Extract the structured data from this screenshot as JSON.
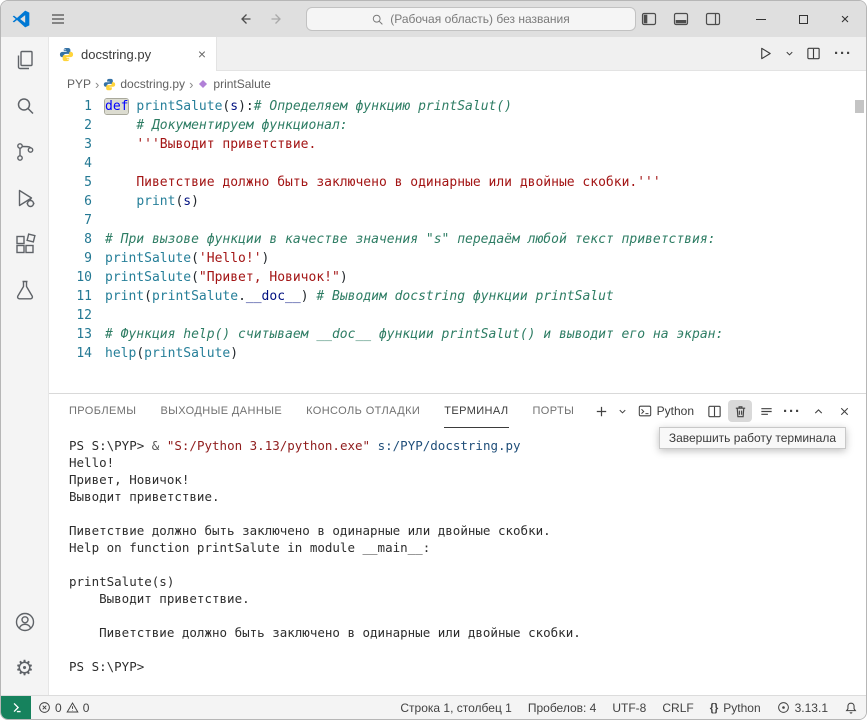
{
  "colors": {
    "accent": "#005fb8",
    "remote_indicator": "#16825d",
    "keyword": "#0000ff",
    "function": "#267f99",
    "string": "#a31515",
    "comment": "#2e7d64",
    "line_number": "#237893",
    "python_blue": "#3572a5",
    "python_yellow": "#ffd43b"
  },
  "titlebar": {
    "command_center": "(Рабочая область) без названия"
  },
  "tab": {
    "label": "docstring.py"
  },
  "breadcrumbs": {
    "items": [
      "PYP",
      "docstring.py",
      "printSalute"
    ]
  },
  "editor": {
    "lines": [
      {
        "n": "1",
        "tokens": [
          {
            "t": "def",
            "c": "k",
            "hl": true
          },
          {
            "t": " ",
            "c": "p"
          },
          {
            "t": "printSalute",
            "c": "f"
          },
          {
            "t": "(",
            "c": "p"
          },
          {
            "t": "s",
            "c": "v"
          },
          {
            "t": "):",
            "c": "p"
          },
          {
            "t": "# Определяем функцию printSalut()",
            "c": "c"
          }
        ]
      },
      {
        "n": "2",
        "tokens": [
          {
            "t": "    ",
            "c": "p"
          },
          {
            "t": "# Документируем функционал:",
            "c": "c"
          }
        ]
      },
      {
        "n": "3",
        "tokens": [
          {
            "t": "    ",
            "c": "p"
          },
          {
            "t": "'''Выводит приветствие.",
            "c": "s"
          }
        ]
      },
      {
        "n": "4",
        "tokens": []
      },
      {
        "n": "5",
        "tokens": [
          {
            "t": "    ",
            "c": "p"
          },
          {
            "t": "Пиветствие должно быть заключено в одинарные или двойные скобки.'''",
            "c": "s"
          }
        ]
      },
      {
        "n": "6",
        "tokens": [
          {
            "t": "    ",
            "c": "p"
          },
          {
            "t": "print",
            "c": "f"
          },
          {
            "t": "(",
            "c": "p"
          },
          {
            "t": "s",
            "c": "v"
          },
          {
            "t": ")",
            "c": "p"
          }
        ]
      },
      {
        "n": "7",
        "tokens": []
      },
      {
        "n": "8",
        "tokens": [
          {
            "t": "# При вызове функции в качестве значения \"s\" передаём любой текст приветствия:",
            "c": "c"
          }
        ]
      },
      {
        "n": "9",
        "tokens": [
          {
            "t": "printSalute",
            "c": "f"
          },
          {
            "t": "(",
            "c": "p"
          },
          {
            "t": "'Hello!'",
            "c": "s"
          },
          {
            "t": ")",
            "c": "p"
          }
        ]
      },
      {
        "n": "10",
        "tokens": [
          {
            "t": "printSalute",
            "c": "f"
          },
          {
            "t": "(",
            "c": "p"
          },
          {
            "t": "\"Привет, Новичок!\"",
            "c": "s"
          },
          {
            "t": ")",
            "c": "p"
          }
        ]
      },
      {
        "n": "11",
        "tokens": [
          {
            "t": "print",
            "c": "f"
          },
          {
            "t": "(",
            "c": "p"
          },
          {
            "t": "printSalute",
            "c": "f"
          },
          {
            "t": ".",
            "c": "p"
          },
          {
            "t": "__doc__",
            "c": "v"
          },
          {
            "t": ") ",
            "c": "p"
          },
          {
            "t": "# Выводим docstring функции printSalut",
            "c": "c"
          }
        ]
      },
      {
        "n": "12",
        "tokens": []
      },
      {
        "n": "13",
        "tokens": [
          {
            "t": "# Функция help() считываем __doc__ функции printSalut() и выводит его на экран:",
            "c": "c"
          }
        ]
      },
      {
        "n": "14",
        "tokens": [
          {
            "t": "help",
            "c": "f"
          },
          {
            "t": "(",
            "c": "p"
          },
          {
            "t": "printSalute",
            "c": "f"
          },
          {
            "t": ")",
            "c": "p"
          }
        ]
      }
    ]
  },
  "panel": {
    "tabs": [
      {
        "id": "problems",
        "label": "ПРОБЛЕМЫ",
        "active": false
      },
      {
        "id": "output",
        "label": "ВЫХОДНЫЕ ДАННЫЕ",
        "active": false
      },
      {
        "id": "debug-console",
        "label": "КОНСОЛЬ ОТЛАДКИ",
        "active": false
      },
      {
        "id": "terminal",
        "label": "ТЕРМИНАЛ",
        "active": true
      },
      {
        "id": "ports",
        "label": "ПОРТЫ",
        "active": false
      }
    ],
    "terminal_name": "Python",
    "tooltip": "Завершить работу терминала",
    "output": [
      {
        "tokens": [
          {
            "t": "PS S:\\PYP> ",
            "c": "d"
          },
          {
            "t": "& ",
            "c": "op"
          },
          {
            "t": "\"S:/Python 3.13/python.exe\"",
            "c": "str"
          },
          {
            "t": " s:/PYP/docstring.py",
            "c": "arg"
          }
        ]
      },
      {
        "tokens": [
          {
            "t": "Hello!",
            "c": "d"
          }
        ]
      },
      {
        "tokens": [
          {
            "t": "Привет, Новичок!",
            "c": "d"
          }
        ]
      },
      {
        "tokens": [
          {
            "t": "Выводит приветствие.",
            "c": "d"
          }
        ]
      },
      {
        "tokens": []
      },
      {
        "tokens": [
          {
            "t": "Пиветствие должно быть заключено в одинарные или двойные скобки.",
            "c": "d"
          }
        ]
      },
      {
        "tokens": [
          {
            "t": "Help on function printSalute in module __main__:",
            "c": "d"
          }
        ]
      },
      {
        "tokens": []
      },
      {
        "tokens": [
          {
            "t": "printSalute(s)",
            "c": "d"
          }
        ]
      },
      {
        "tokens": [
          {
            "t": "    Выводит приветствие.",
            "c": "d"
          }
        ]
      },
      {
        "tokens": []
      },
      {
        "tokens": [
          {
            "t": "    Пиветствие должно быть заключено в одинарные или двойные скобки.",
            "c": "d"
          }
        ]
      },
      {
        "tokens": []
      },
      {
        "tokens": [
          {
            "t": "PS S:\\PYP>",
            "c": "d"
          }
        ]
      }
    ]
  },
  "statusbar": {
    "errors": "0",
    "warnings": "0",
    "cursor": "Строка 1, столбец 1",
    "indent": "Пробелов: 4",
    "encoding": "UTF-8",
    "eol": "CRLF",
    "language": "Python",
    "py_version": "3.13.1"
  }
}
